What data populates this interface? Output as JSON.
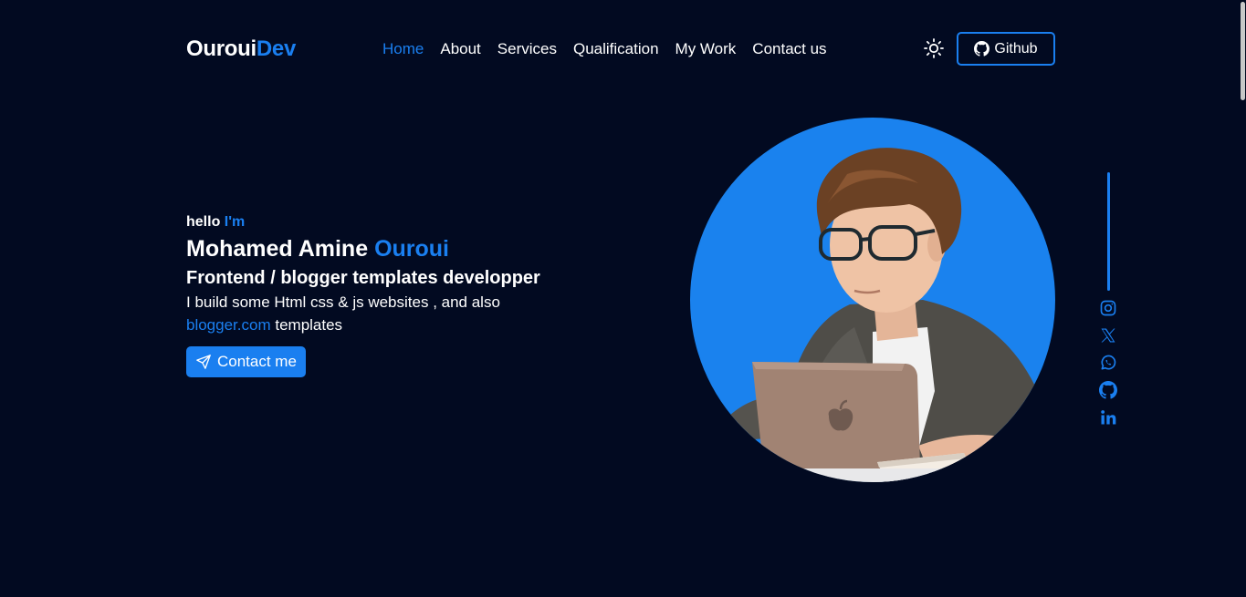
{
  "header": {
    "logo_main": "Ouroui",
    "logo_accent": "Dev",
    "nav": [
      {
        "label": "Home",
        "active": true
      },
      {
        "label": "About",
        "active": false
      },
      {
        "label": "Services",
        "active": false
      },
      {
        "label": "Qualification",
        "active": false
      },
      {
        "label": "My Work",
        "active": false
      },
      {
        "label": "Contact us",
        "active": false
      }
    ],
    "theme_icon": "sun-icon",
    "github_label": "Github"
  },
  "hero": {
    "greeting_main": "hello",
    "greeting_accent": "I'm",
    "name_main": "Mohamed Amine",
    "name_accent": "Ouroui",
    "role": "Frontend / blogger templates developper",
    "desc_line1": "I build some Html css & js websites , and also",
    "desc_link": "blogger.com",
    "desc_tail": "templates",
    "cta_label": "Contact me",
    "cta_icon": "send-icon"
  },
  "social": [
    "instagram-icon",
    "x-icon",
    "whatsapp-icon",
    "github-icon",
    "linkedin-icon"
  ],
  "colors": {
    "background": "#020a21",
    "accent": "#1a7ff0",
    "text": "#ffffff"
  }
}
